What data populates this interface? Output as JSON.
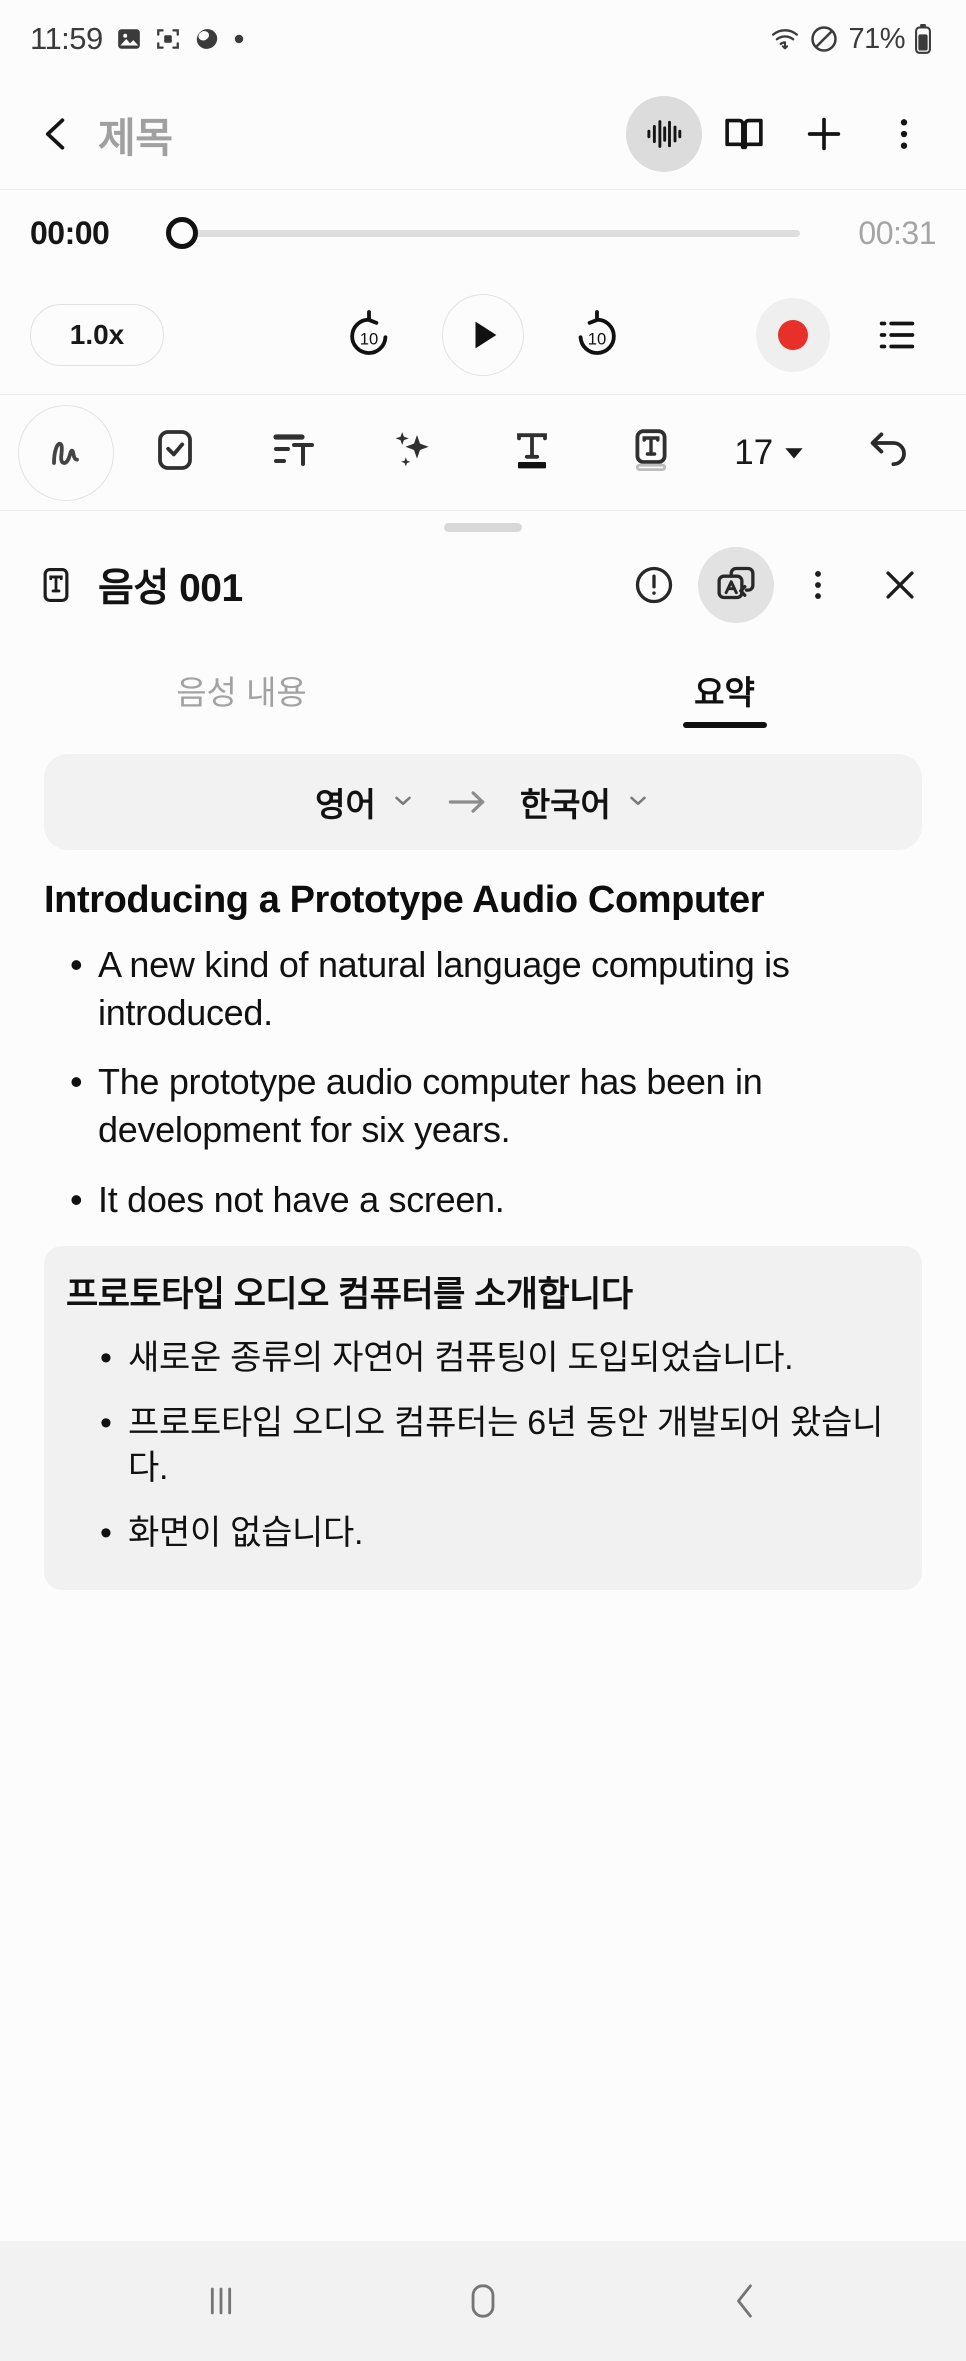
{
  "status_bar": {
    "time": "11:59",
    "battery_percent": "71%",
    "left_icons": [
      "photo-icon",
      "screen-capture-icon",
      "bixby-icon",
      "dot-icon"
    ],
    "right_icons": [
      "wifi-icon",
      "do-not-disturb-icon",
      "battery-icon"
    ]
  },
  "app_bar": {
    "back_icon": "back-chevron-icon",
    "title": "제목",
    "actions": [
      {
        "name": "waveform-icon",
        "active": true
      },
      {
        "name": "book-icon",
        "active": false
      },
      {
        "name": "plus-icon",
        "active": false
      },
      {
        "name": "more-vertical-icon",
        "active": false
      }
    ]
  },
  "player": {
    "current_time": "00:00",
    "total_time": "00:31",
    "progress_percent": 0,
    "speed_label": "1.0x",
    "rewind_label": "10",
    "forward_label": "10",
    "controls": [
      "rewind-10-button",
      "play-button",
      "forward-10-button",
      "record-button",
      "list-button"
    ],
    "record_color": "#e8302a"
  },
  "format_toolbar": {
    "items": [
      {
        "name": "handwriting-icon",
        "circled": true
      },
      {
        "name": "checkbox-icon",
        "circled": false
      },
      {
        "name": "text-list-icon",
        "circled": false
      },
      {
        "name": "ai-sparkle-icon",
        "circled": false
      },
      {
        "name": "text-style-icon",
        "circled": false
      },
      {
        "name": "text-box-icon",
        "circled": false
      }
    ],
    "font_size": "17",
    "undo_icon": "undo-icon"
  },
  "panel": {
    "icon": "text-box-icon",
    "title": "음성 001",
    "actions": [
      {
        "name": "info-icon",
        "active": false
      },
      {
        "name": "translate-icon",
        "active": true
      },
      {
        "name": "more-vertical-icon",
        "active": false
      },
      {
        "name": "close-icon",
        "active": false
      }
    ],
    "tabs": [
      {
        "label": "음성 내용",
        "active": false
      },
      {
        "label": "요약",
        "active": true
      }
    ],
    "language": {
      "source": "영어",
      "target": "한국어",
      "arrow": "arrow-right-icon"
    },
    "summary": {
      "title": "Introducing a Prototype Audio Computer",
      "bullets": [
        "A new kind of natural language computing is introduced.",
        "The prototype audio computer has been in development for six years.",
        "It does not have a screen."
      ]
    },
    "translation": {
      "title": "프로토타입 오디오 컴퓨터를 소개합니다",
      "bullets": [
        "새로운 종류의 자연어 컴퓨팅이 도입되었습니다.",
        "프로토타입 오디오 컴퓨터는 6년 동안 개발되어 왔습니다.",
        "화면이 없습니다."
      ],
      "background_color": "#f1f1f1"
    }
  },
  "nav_bar": {
    "buttons": [
      "recents-button",
      "home-button",
      "back-button"
    ]
  }
}
